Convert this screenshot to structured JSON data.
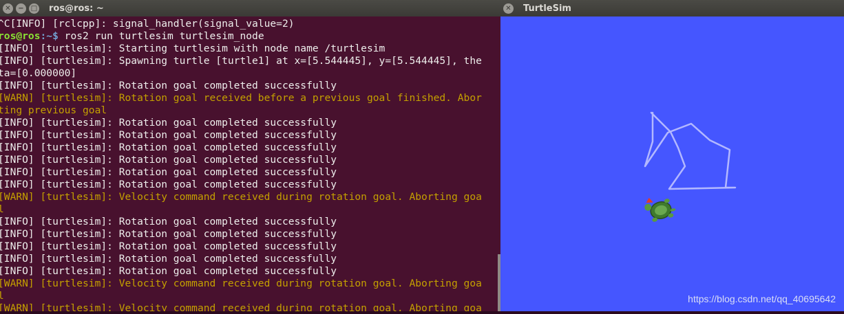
{
  "terminal": {
    "title": "ros@ros: ~",
    "lines": [
      {
        "type": "info",
        "text": "^C[INFO] [rclcpp]: signal_handler(signal_value=2)"
      },
      {
        "type": "prompt",
        "user": "ros@ros",
        "path": ":~$",
        "cmd": " ros2 run turtlesim turtlesim_node"
      },
      {
        "type": "info",
        "text": "[INFO] [turtlesim]: Starting turtlesim with node name /turtlesim"
      },
      {
        "type": "info",
        "text": "[INFO] [turtlesim]: Spawning turtle [turtle1] at x=[5.544445], y=[5.544445], the"
      },
      {
        "type": "info",
        "text": "ta=[0.000000]"
      },
      {
        "type": "info",
        "text": "[INFO] [turtlesim]: Rotation goal completed successfully"
      },
      {
        "type": "warn",
        "text": "[WARN] [turtlesim]: Rotation goal received before a previous goal finished. Abor"
      },
      {
        "type": "warn",
        "text": "ting previous goal"
      },
      {
        "type": "info",
        "text": "[INFO] [turtlesim]: Rotation goal completed successfully"
      },
      {
        "type": "info",
        "text": "[INFO] [turtlesim]: Rotation goal completed successfully"
      },
      {
        "type": "info",
        "text": "[INFO] [turtlesim]: Rotation goal completed successfully"
      },
      {
        "type": "info",
        "text": "[INFO] [turtlesim]: Rotation goal completed successfully"
      },
      {
        "type": "info",
        "text": "[INFO] [turtlesim]: Rotation goal completed successfully"
      },
      {
        "type": "info",
        "text": "[INFO] [turtlesim]: Rotation goal completed successfully"
      },
      {
        "type": "warn",
        "text": "[WARN] [turtlesim]: Velocity command received during rotation goal. Aborting goa"
      },
      {
        "type": "warn",
        "text": "l"
      },
      {
        "type": "info",
        "text": "[INFO] [turtlesim]: Rotation goal completed successfully"
      },
      {
        "type": "info",
        "text": "[INFO] [turtlesim]: Rotation goal completed successfully"
      },
      {
        "type": "info",
        "text": "[INFO] [turtlesim]: Rotation goal completed successfully"
      },
      {
        "type": "info",
        "text": "[INFO] [turtlesim]: Rotation goal completed successfully"
      },
      {
        "type": "info",
        "text": "[INFO] [turtlesim]: Rotation goal completed successfully"
      },
      {
        "type": "warn",
        "text": "[WARN] [turtlesim]: Velocity command received during rotation goal. Aborting goa"
      },
      {
        "type": "warn",
        "text": "l"
      },
      {
        "type": "warn",
        "text": "[WARN] [turtlesim]: Velocity command received during rotation goal. Aborting goa"
      }
    ]
  },
  "turtlesim": {
    "title": "TurtleSim",
    "watermark": "https://blog.csdn.net/qq_40695642"
  },
  "colors": {
    "canvas": "#4556ff",
    "trail": "#b3b8ff",
    "terminal_bg": "#4a1d33",
    "warn": "#c4a000"
  },
  "icons": {
    "close": "close-icon",
    "minimize": "minimize-icon",
    "maximize": "maximize-icon",
    "turtle": "turtle-icon"
  }
}
